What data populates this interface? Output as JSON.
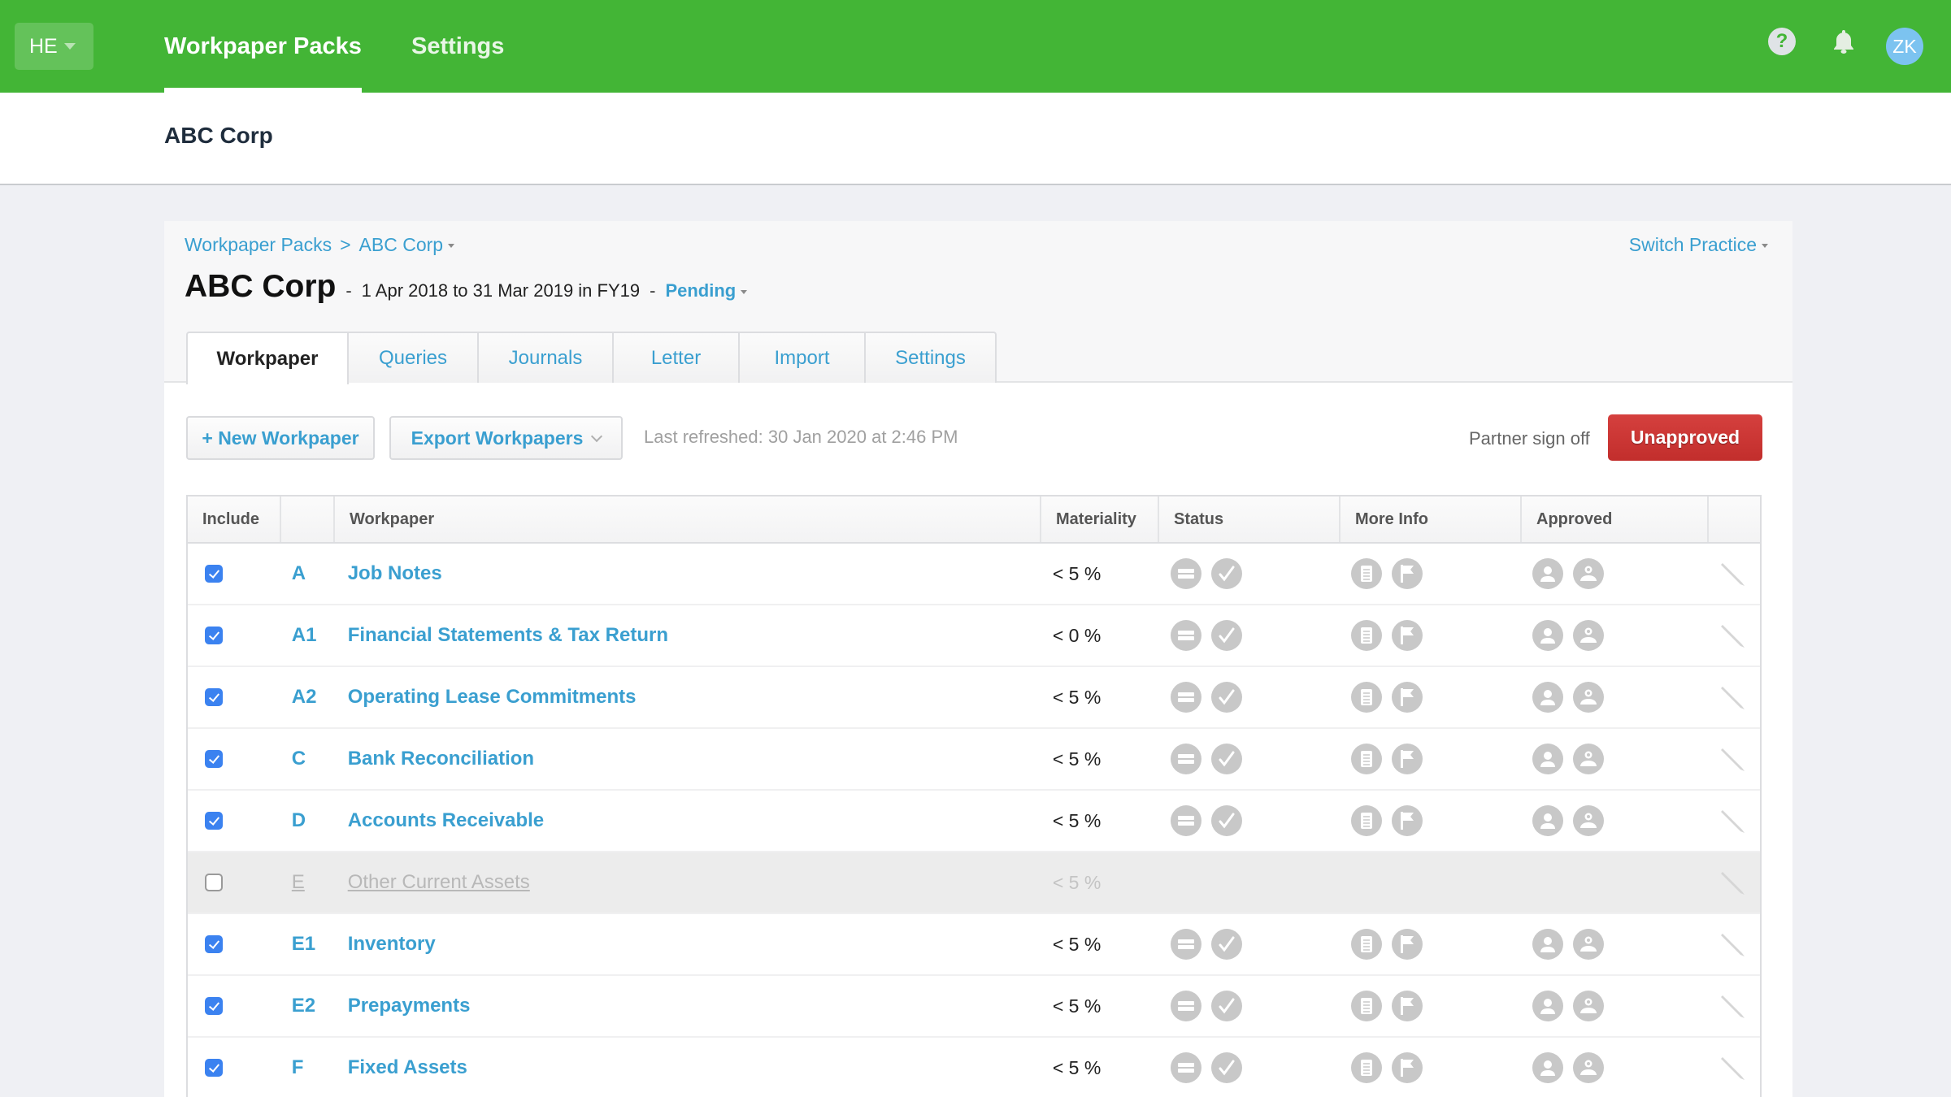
{
  "topbar": {
    "org_initials": "HE",
    "nav": [
      {
        "label": "Workpaper Packs",
        "active": true
      },
      {
        "label": "Settings",
        "active": false
      }
    ],
    "help_icon": "question-circle-icon",
    "notification_icon": "bell-icon",
    "user_initials": "ZK",
    "brand_color": "#43b536"
  },
  "subheader": {
    "client_name": "ABC Corp"
  },
  "breadcrumb": {
    "items": [
      "Workpaper Packs",
      "ABC Corp"
    ],
    "separator": ">"
  },
  "switch_practice": "Switch Practice",
  "page": {
    "title": "ABC Corp",
    "separator": "-",
    "period": "1 Apr 2018 to 31 Mar 2019 in FY19",
    "status": "Pending"
  },
  "tabs": [
    {
      "label": "Workpaper",
      "active": true
    },
    {
      "label": "Queries",
      "active": false
    },
    {
      "label": "Journals",
      "active": false
    },
    {
      "label": "Letter",
      "active": false
    },
    {
      "label": "Import",
      "active": false
    },
    {
      "label": "Settings",
      "active": false
    }
  ],
  "toolbar": {
    "new_workpaper": "+ New Workpaper",
    "export_workpapers": "Export Workpapers",
    "last_refreshed": "Last refreshed: 30 Jan 2020 at 2:46 PM",
    "partner_label": "Partner sign off",
    "partner_status": "Unapproved",
    "partner_status_color": "#c83533"
  },
  "table": {
    "columns": [
      "Include",
      "",
      "Workpaper",
      "Materiality",
      "Status",
      "More Info",
      "Approved",
      ""
    ],
    "rows": [
      {
        "include": true,
        "ref": "A",
        "name": "Job Notes",
        "materiality": "< 5 %"
      },
      {
        "include": true,
        "ref": "A1",
        "name": "Financial Statements & Tax Return",
        "materiality": "< 0 %"
      },
      {
        "include": true,
        "ref": "A2",
        "name": "Operating Lease Commitments",
        "materiality": "< 5 %"
      },
      {
        "include": true,
        "ref": "C",
        "name": "Bank Reconciliation",
        "materiality": "< 5 %"
      },
      {
        "include": true,
        "ref": "D",
        "name": "Accounts Receivable",
        "materiality": "< 5 %"
      },
      {
        "include": false,
        "ref": "E",
        "name": "Other Current Assets",
        "materiality": "< 5 %"
      },
      {
        "include": true,
        "ref": "E1",
        "name": "Inventory",
        "materiality": "< 5 %"
      },
      {
        "include": true,
        "ref": "E2",
        "name": "Prepayments",
        "materiality": "< 5 %"
      },
      {
        "include": true,
        "ref": "F",
        "name": "Fixed Assets",
        "materiality": "< 5 %"
      }
    ],
    "row_icons": {
      "status": [
        "not-applicable-icon",
        "checkmark-icon"
      ],
      "more_info": [
        "notes-icon",
        "flag-icon"
      ],
      "approved": [
        "preparer-icon",
        "reviewer-icon"
      ],
      "edit": "pencil-icon"
    }
  }
}
